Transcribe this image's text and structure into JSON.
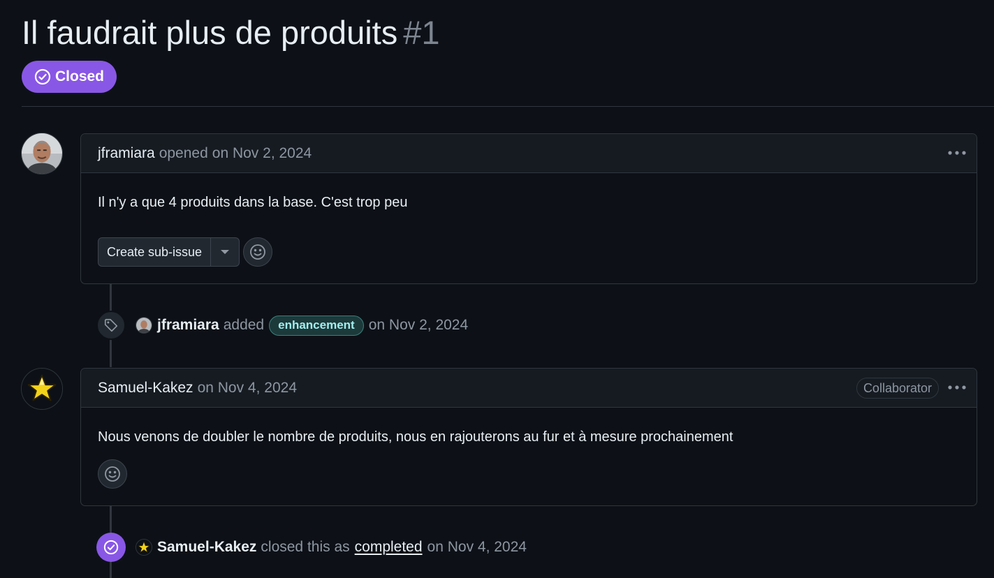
{
  "issue": {
    "title": "Il faudrait plus de produits",
    "number": "#1",
    "state": "Closed",
    "state_color": "#8957e5"
  },
  "comments": [
    {
      "author": "jframiara",
      "action": "opened",
      "date": "on Nov 2, 2024",
      "body": "Il n'y a que 4 produits dans la base. C'est trop peu",
      "sub_issue_button": "Create sub-issue",
      "avatar": "photo-avatar"
    },
    {
      "author": "Samuel-Kakez",
      "date": "on Nov 4, 2024",
      "role": "Collaborator",
      "body": "Nous venons de doubler le nombre de produits, nous en rajouterons au fur et à mesure prochainement",
      "avatar": "star-avatar"
    }
  ],
  "events": {
    "label_event": {
      "actor": "jframiara",
      "verb": "added",
      "label": "enhancement",
      "label_color": "#a2eeef",
      "date": "on Nov 2, 2024",
      "icon": "tag-icon"
    },
    "close_event": {
      "actor": "Samuel-Kakez",
      "verb": "closed this as",
      "reason": "completed",
      "date": "on Nov 4, 2024",
      "icon": "check-circle-icon"
    }
  },
  "theme": {
    "background": "#0d1117",
    "border": "#30363d",
    "muted_text": "#8d96a0"
  }
}
